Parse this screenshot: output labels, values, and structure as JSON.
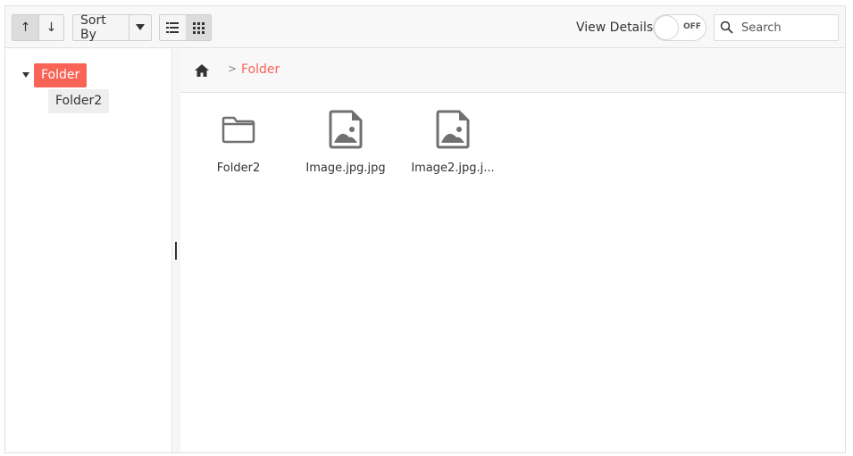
{
  "toolbar": {
    "sort_asc_label": "↑",
    "sort_desc_label": "↓",
    "sort_by_label": "Sort By",
    "view_details_label": "View Details",
    "toggle_state_label": "OFF",
    "search_placeholder": "Search"
  },
  "navigation": {
    "nodes": [
      {
        "label": "Folder",
        "selected": true,
        "expanded": true
      },
      {
        "label": "Folder2",
        "selected": false
      }
    ]
  },
  "breadcrumb": {
    "items": [
      "Folder"
    ]
  },
  "content": {
    "items": [
      {
        "label": "Folder2",
        "type": "folder"
      },
      {
        "label": "Image.jpg.jpg",
        "type": "image"
      },
      {
        "label": "Image2.jpg.j...",
        "type": "image"
      }
    ]
  },
  "colors": {
    "accent": "#f96457",
    "icon": "#707070"
  }
}
